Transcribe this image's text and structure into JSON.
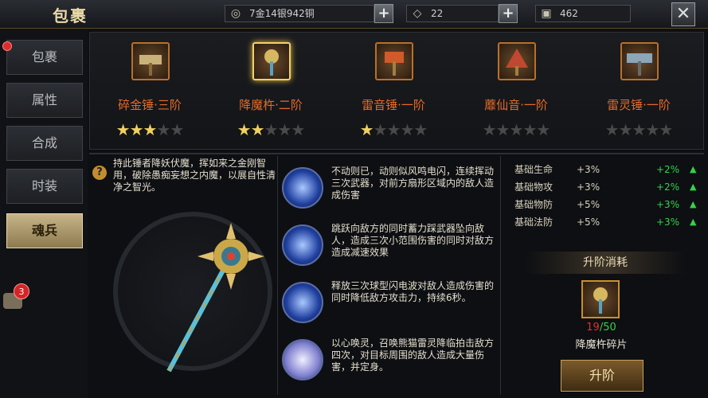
{
  "header": {
    "title": "包裹",
    "copper": "7金14银942铜",
    "diamonds": "22",
    "bag": "462"
  },
  "sidebar": {
    "tabs": [
      "包裹",
      "属性",
      "合成",
      "时装",
      "魂兵"
    ],
    "active_index": 4,
    "chat_badge": "3"
  },
  "weapons": [
    {
      "name": "碎金锤·三阶",
      "stars": 3,
      "max_stars": 5
    },
    {
      "name": "降魔杵·二阶",
      "stars": 2,
      "max_stars": 5
    },
    {
      "name": "雷音锤·一阶",
      "stars": 1,
      "max_stars": 5
    },
    {
      "name": "蘼仙音·一阶",
      "stars": 0,
      "max_stars": 5
    },
    {
      "name": "雷灵锤·一阶",
      "stars": 0,
      "max_stars": 5
    }
  ],
  "description": "持此锤者降妖伏魔，挥如来之金刚智用，破除愚痴妄想之内魔，以展自性清净之智光。",
  "skills": [
    "不动则已，动则似风鸣电闪，连续挥动三次武器，对前方扇形区域内的敌人造成伤害",
    "跳跃向敌方的同时蓄力踩武器坠向敌人，造成三次小范围伤害的同时对敌方造成减速效果",
    "释放三次球型闪电波对敌人造成伤害的同时降低敌方攻击力，持续6秒。",
    "以心唤灵，召唤熊猫雷灵降临拍击敌方四次，对目标周围的敌人造成大量伤害，并定身。"
  ],
  "attributes": [
    {
      "name": "基础生命",
      "value": "+3%",
      "bonus": "+2%"
    },
    {
      "name": "基础物攻",
      "value": "+3%",
      "bonus": "+2%"
    },
    {
      "name": "基础物防",
      "value": "+5%",
      "bonus": "+3%"
    },
    {
      "name": "基础法防",
      "value": "+5%",
      "bonus": "+3%"
    }
  ],
  "upgrade": {
    "title": "升阶消耗",
    "have": "19",
    "need": "/50",
    "material": "降魔杵碎片",
    "button": "升阶"
  },
  "colors": {
    "weapon_name": "#e46a2a",
    "bonus_green": "#35d24a",
    "shortage_red": "#e03030"
  }
}
